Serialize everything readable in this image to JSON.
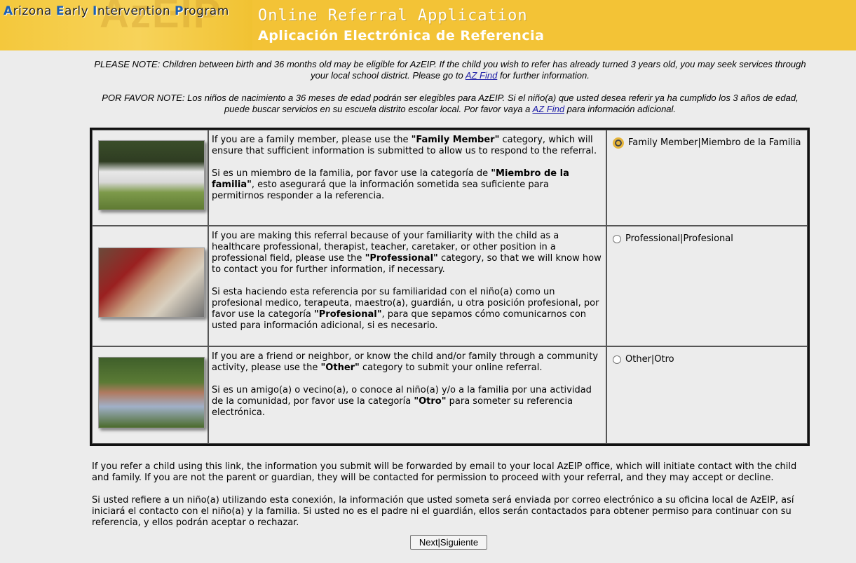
{
  "header": {
    "program_name": "Arizona Early Intervention Program",
    "watermark": "AzEIP",
    "title_en": "Online Referral Application",
    "title_es": "Aplicación  Electrónica de Referencia"
  },
  "notes": {
    "en_before_link": "PLEASE NOTE: Children between birth and 36 months old may be eligible for AzEIP. If the child you wish to refer has already turned 3 years old, you may seek services through your local school district. Please go to ",
    "en_link": "AZ Find",
    "en_after_link": " for further information.",
    "es_before_link": "POR FAVOR NOTE: Los niños de nacimiento a 36 meses de edad podrán ser elegibles para AzEIP. Si el niño(a) que usted desea referir ya ha cumplido los 3 años de edad, puede buscar servicios en su escuela distrito escolar local. Por favor vaya a ",
    "es_link": "AZ Find",
    "es_after_link": " para información adicional."
  },
  "categories": [
    {
      "en_pre": "If you are a family member, please use the ",
      "en_bold": "\"Family Member\"",
      "en_post": " category, which will ensure that sufficient information is submitted to allow us to respond to the referral.",
      "es_pre": "Si es un miembro de la familia, por favor use la categoría de ",
      "es_bold": "\"Miembro de la familia\"",
      "es_post": ", esto asegurará que la información sometida sea suficiente para permitirnos responder a la referencia.",
      "option_label": "Family Member|Miembro de la Familia",
      "selected": true
    },
    {
      "en_pre": "If you are making this referral because of your familiarity with the child as a healthcare professional, therapist, teacher, caretaker, or other position in a professional field, please use the ",
      "en_bold": "\"Professional\"",
      "en_post": " category, so that we will know how to contact you for further information, if necessary.",
      "es_pre": "Si esta haciendo esta referencia por su familiaridad con el niño(a) como un profesional medico, terapeuta, maestro(a), guardián, u otra posición profesional, por favor use la categoría ",
      "es_bold": "\"Profesional\"",
      "es_post": ", para que sepamos cómo comunicarnos con usted para información adicional, si es necesario.",
      "option_label": "Professional|Profesional",
      "selected": false
    },
    {
      "en_pre": "If you are a friend or neighbor, or know the child and/or family through a community activity, please use the ",
      "en_bold": "\"Other\"",
      "en_post": " category to submit your online referral.",
      "es_pre": "Si es un amigo(a) o vecino(a), o conoce al niño(a) y/o a la familia por una actividad de la comunidad, por favor use la categoría ",
      "es_bold": "\"Otro\"",
      "es_post": " para someter su referencia electrónica.",
      "option_label": "Other|Otro",
      "selected": false
    }
  ],
  "footer": {
    "en": "If you refer a child using this link, the information you submit will be forwarded by email to your local AzEIP office, which will initiate contact with the child and family. If you are not the parent or guardian, they will be contacted for permission to proceed with your referral, and they may accept or decline.",
    "es": "Si usted refiere a un niño(a) utilizando esta conexión, la información que usted someta será enviada por correo electrónico a su oficina local de AzEIP, así iniciará el contacto con el niño(a) y la familia. Si usted no es el padre ni el guardián, ellos serán contactados para obtener permiso para continuar con su referencia, y ellos podrán aceptar o rechazar.",
    "next_button": "Next|Siguiente"
  },
  "colors": {
    "banner": "#f3c336",
    "link": "#1a1aa6",
    "radio_focus": "#e6b53a"
  }
}
